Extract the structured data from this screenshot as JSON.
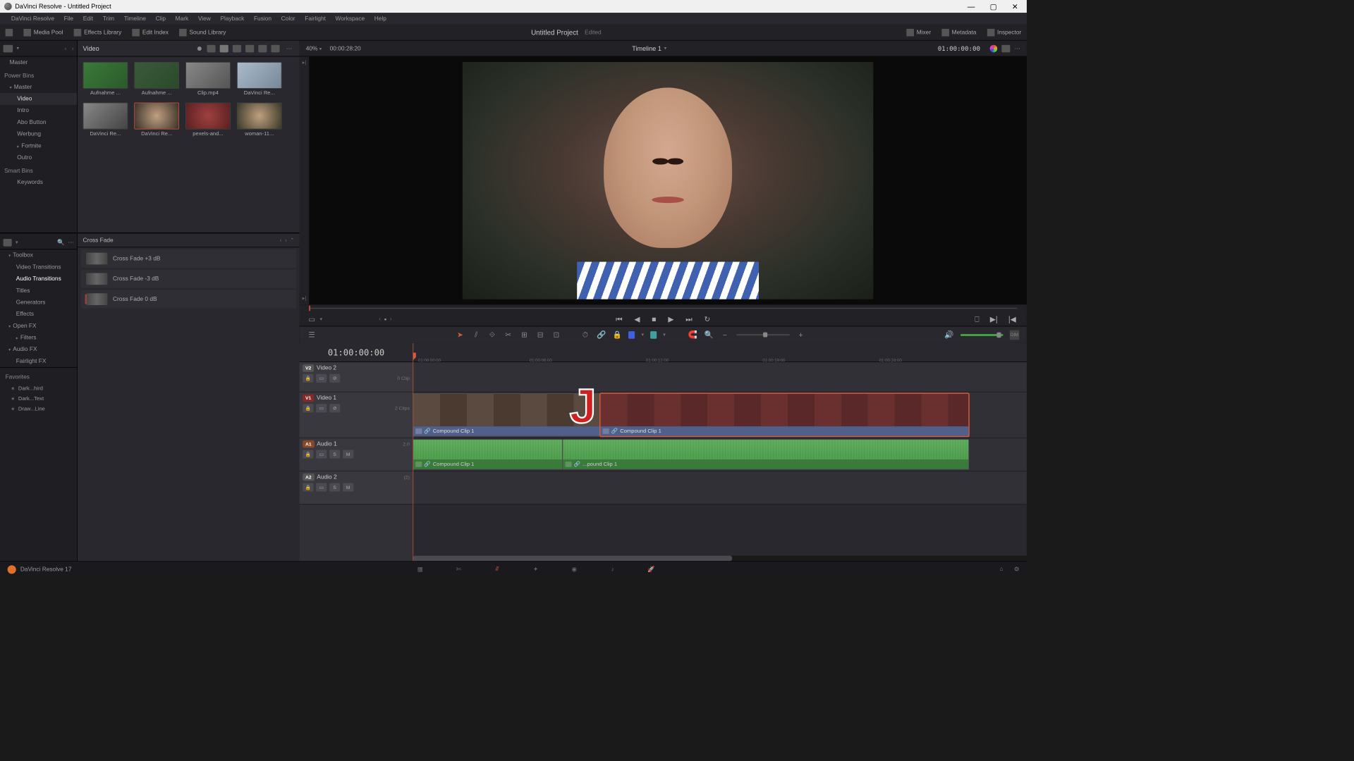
{
  "titlebar": {
    "title": "DaVinci Resolve - Untitled Project"
  },
  "menubar": [
    "DaVinci Resolve",
    "File",
    "Edit",
    "Trim",
    "Timeline",
    "Clip",
    "Mark",
    "View",
    "Playback",
    "Fusion",
    "Color",
    "Fairlight",
    "Workspace",
    "Help"
  ],
  "toolbar": {
    "media_pool": "Media Pool",
    "effects_library": "Effects Library",
    "edit_index": "Edit Index",
    "sound_library": "Sound Library",
    "project": "Untitled Project",
    "edited": "Edited",
    "mixer": "Mixer",
    "metadata": "Metadata",
    "inspector": "Inspector"
  },
  "bins": {
    "master": "Master",
    "power_bins": "Power Bins",
    "pb_master": "Master",
    "items": [
      "Video",
      "Intro",
      "Abo Button",
      "Werbung",
      "Fortnite",
      "Outro"
    ],
    "smart_bins": "Smart Bins",
    "keywords": "Keywords"
  },
  "media": {
    "folder": "Video",
    "clips": [
      {
        "name": "Aufnahme ..."
      },
      {
        "name": "Aufnahme ..."
      },
      {
        "name": "Clip.mp4"
      },
      {
        "name": "DaVinci Re..."
      },
      {
        "name": "DaVinci Re..."
      },
      {
        "name": "DaVinci Re...",
        "selected": true
      },
      {
        "name": "pexels-and..."
      },
      {
        "name": "woman-11..."
      }
    ]
  },
  "fx": {
    "toolbox": "Toolbox",
    "tree": [
      "Video Transitions",
      "Audio Transitions",
      "Titles",
      "Generators",
      "Effects"
    ],
    "open_fx": "Open FX",
    "filters": "Filters",
    "audio_fx": "Audio FX",
    "fairlight_fx": "Fairlight FX",
    "category": "Cross Fade",
    "entries": [
      "Cross Fade +3 dB",
      "Cross Fade -3 dB",
      "Cross Fade 0 dB"
    ],
    "favorites_title": "Favorites",
    "favorites": [
      "Dark...hird",
      "Dark...Text",
      "Draw...Line"
    ]
  },
  "viewer": {
    "zoom": "40%",
    "source_tc": "00:00:28:20",
    "timeline_name": "Timeline 1",
    "record_tc": "01:00:00:00"
  },
  "timeline": {
    "display_tc": "01:00:00:00",
    "ruler_ticks": [
      "01:00:00:00",
      "01:00:06:00",
      "01:00:12:00",
      "01:00:19:00",
      "01:00:24:00"
    ],
    "tracks": {
      "v2": {
        "badge": "V2",
        "name": "Video 2",
        "info": "0 Clip"
      },
      "v1": {
        "badge": "V1",
        "name": "Video 1",
        "info": "2 Clips"
      },
      "a1": {
        "badge": "A1",
        "name": "Audio 1",
        "ch": "2.0"
      },
      "a2": {
        "badge": "A2",
        "name": "Audio 2",
        "ch": "(2)"
      }
    },
    "clips": {
      "v1a": "Compound Clip 1",
      "v1b": "Compound Clip 1",
      "a1a": "Compound Clip 1",
      "a1b": "...pound Clip 1"
    },
    "overlay_key": "J",
    "track_btns": {
      "lock": "",
      "autosel": "",
      "solo": "S",
      "mute": "M"
    }
  },
  "bottombar": {
    "version": "DaVinci Resolve 17"
  }
}
